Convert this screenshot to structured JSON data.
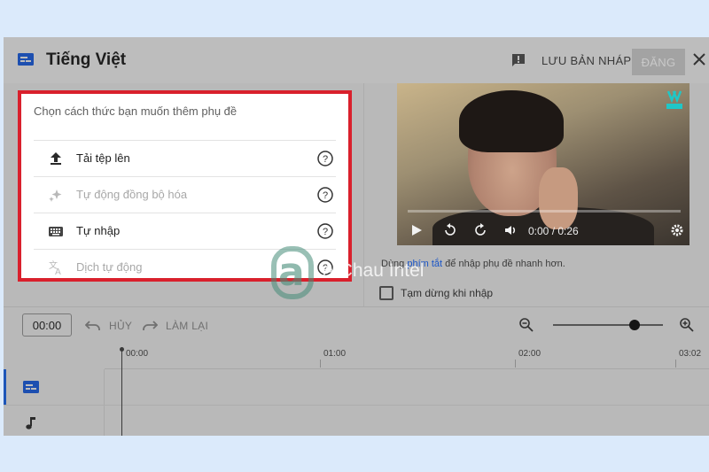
{
  "header": {
    "title": "Tiếng Việt",
    "save_draft": "LƯU BẢN NHÁP",
    "publish": "ĐĂNG"
  },
  "panel": {
    "title": "Chọn cách thức bạn muốn thêm phụ đề",
    "options": [
      {
        "label": "Tải tệp lên",
        "icon": "upload-icon",
        "enabled": true
      },
      {
        "label": "Tự động đồng bộ hóa",
        "icon": "auto-sync-sparkle-icon",
        "enabled": false
      },
      {
        "label": "Tự nhập",
        "icon": "keyboard-icon",
        "enabled": true
      },
      {
        "label": "Dịch tự động",
        "icon": "translate-icon",
        "enabled": false
      }
    ]
  },
  "video": {
    "time": "0:00 / 0:26",
    "channel_logo": "vlive-logo",
    "progress": 0
  },
  "shortcut": {
    "prefix": "Dùng",
    "link": "phím tắt",
    "suffix": "để nhập phụ đề nhanh hơn."
  },
  "pause_while_typing": {
    "label": "Tạm dừng khi nhập",
    "checked": false
  },
  "timeline": {
    "current_time": "00:00",
    "undo": "HỦY",
    "redo": "LÀM LẠI",
    "zoom_level": 0.74,
    "ticks": [
      "00:00",
      "01:00",
      "02:00",
      "03:02"
    ],
    "tracks": [
      {
        "icon": "subtitles-icon",
        "active": true
      },
      {
        "icon": "music-note-icon",
        "active": false
      }
    ]
  },
  "watermark": {
    "text": "A Chau Intel"
  },
  "colors": {
    "highlight_border": "#d9202c",
    "link": "#1a55c7",
    "track_accent": "#1c55b8"
  }
}
